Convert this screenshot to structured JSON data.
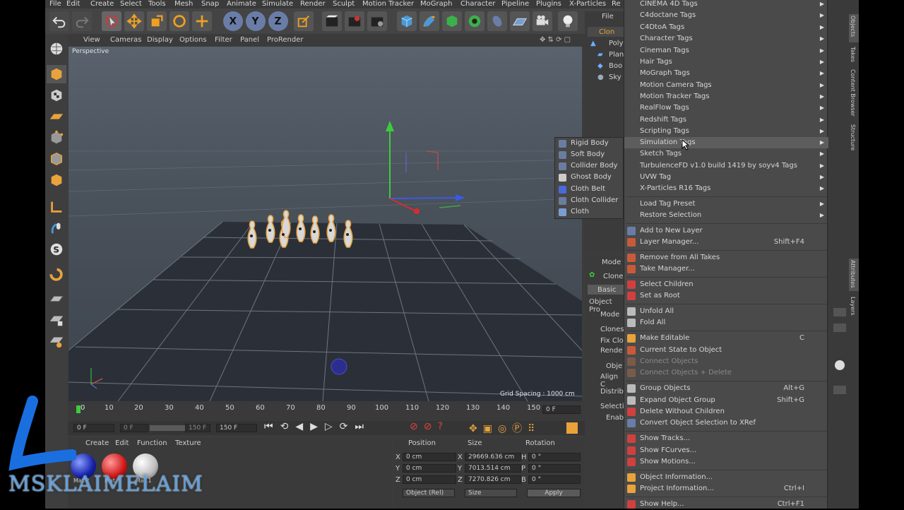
{
  "menubar": [
    "File",
    "Edit",
    "Create",
    "Select",
    "Tools",
    "Mesh",
    "Snap",
    "Animate",
    "Simulate",
    "Render",
    "Sculpt",
    "Motion Tracker",
    "MoGraph",
    "Character",
    "Pipeline",
    "Plugins",
    "X-Particles",
    "Re"
  ],
  "viewport_menu": [
    "View",
    "Cameras",
    "Display",
    "Options",
    "Filter",
    "Panel",
    "ProRender"
  ],
  "viewport": {
    "label": "Perspective",
    "grid_spacing": "Grid Spacing : 1000 cm"
  },
  "timeline": {
    "ticks": [
      "0",
      "10",
      "20",
      "30",
      "40",
      "50",
      "60",
      "70",
      "80",
      "90",
      "100",
      "110",
      "120",
      "130",
      "140",
      "150"
    ],
    "frame_field": "0 F"
  },
  "transport": {
    "start": "0 F",
    "current": "0 F",
    "end_a": "150 F",
    "end_b": "150 F"
  },
  "material_manager": {
    "menu": [
      "Create",
      "Edit",
      "Function",
      "Texture"
    ],
    "materials": [
      "Mat.2",
      "Mat",
      "Mat.1"
    ]
  },
  "coordinates": {
    "headers": [
      "Position",
      "Size",
      "Rotation"
    ],
    "rows": [
      {
        "axis": "X",
        "pos": "0 cm",
        "size_axis": "X",
        "size": "29669.636 cm",
        "rot_axis": "H",
        "rot": "0 °"
      },
      {
        "axis": "Y",
        "pos": "0 cm",
        "size_axis": "Y",
        "size": "7013.514 cm",
        "rot_axis": "P",
        "rot": "0 °"
      },
      {
        "axis": "Z",
        "pos": "0 cm",
        "size_axis": "Z",
        "size": "7270.826 cm",
        "rot_axis": "B",
        "rot": "0 °"
      }
    ],
    "mode": "Object (Rel)",
    "size_mode": "Size",
    "apply": "Apply"
  },
  "object_manager": {
    "header": "File",
    "items": [
      "Clon",
      "Poly",
      "Plan",
      "Boo",
      "Sky"
    ]
  },
  "attributes": {
    "mode": "Mode",
    "object": "Clone",
    "tab": "Basic",
    "section": "Object Pro",
    "fields": [
      "Mode",
      "Clones",
      "Fix Clo",
      "Rende",
      "Obje",
      "Align C",
      "Distrib",
      "Selectio",
      "Enab"
    ]
  },
  "right_tabs": [
    "Objects",
    "Takes",
    "Content Browser",
    "Structure",
    "Attributes",
    "Layers"
  ],
  "context_menu": {
    "tag_items": [
      "CINEMA 4D Tags",
      "C4doctane Tags",
      "C4DtoA Tags",
      "Character Tags",
      "Cineman Tags",
      "Hair Tags",
      "MoGraph Tags",
      "Motion Camera Tags",
      "Motion Tracker Tags",
      "RealFlow Tags",
      "Redshift Tags",
      "Scripting Tags",
      "Simulation Tags",
      "Sketch Tags",
      "TurbulenceFD v1.0 build 1419 by soyv4 Tags",
      "UVW Tag",
      "X-Particles R16 Tags"
    ],
    "preset_items": [
      "Load Tag Preset",
      "Restore Selection"
    ],
    "layer_items": [
      {
        "label": "Add to New Layer",
        "shortcut": ""
      },
      {
        "label": "Layer Manager...",
        "shortcut": "Shift+F4"
      }
    ],
    "take_items": [
      "Remove from All Takes",
      "Take Manager..."
    ],
    "select_items": [
      "Select Children",
      "Set as Root"
    ],
    "fold_items": [
      "Unfold All",
      "Fold All"
    ],
    "edit_items": [
      {
        "label": "Make Editable",
        "shortcut": "C",
        "disabled": false
      },
      {
        "label": "Current State to Object",
        "shortcut": "",
        "disabled": false
      },
      {
        "label": "Connect Objects",
        "shortcut": "",
        "disabled": true
      },
      {
        "label": "Connect Objects + Delete",
        "shortcut": "",
        "disabled": true
      }
    ],
    "group_items": [
      {
        "label": "Group Objects",
        "shortcut": "Alt+G"
      },
      {
        "label": "Expand Object Group",
        "shortcut": "Shift+G"
      },
      {
        "label": "Delete Without Children",
        "shortcut": ""
      },
      {
        "label": "Convert Object Selection to XRef",
        "shortcut": ""
      }
    ],
    "show_items": [
      "Show Tracks...",
      "Show FCurves...",
      "Show Motions..."
    ],
    "info_items": [
      {
        "label": "Object Information...",
        "shortcut": ""
      },
      {
        "label": "Project Information...",
        "shortcut": "Ctrl+I"
      }
    ],
    "help_item": {
      "label": "Show Help...",
      "shortcut": "Ctrl+F1"
    }
  },
  "submenu": [
    "Rigid Body",
    "Soft Body",
    "Collider Body",
    "Ghost Body",
    "Cloth Belt",
    "Cloth Collider",
    "Cloth"
  ],
  "watermark": "MSKLAIMELAIM",
  "colors": {
    "accent_orange": "#e8a33b",
    "highlight": "#5d5d5d",
    "logo_blue": "#1a6fe0"
  }
}
